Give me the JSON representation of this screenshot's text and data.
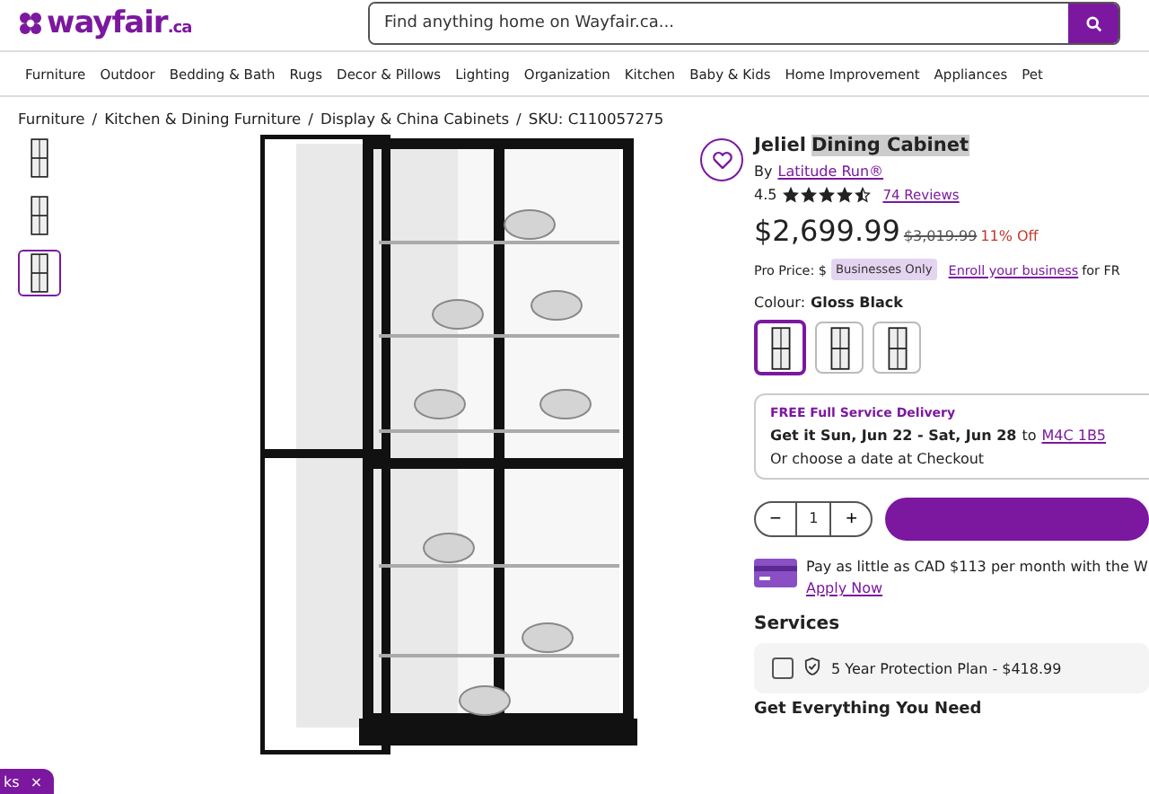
{
  "header": {
    "logo": "wayfair",
    "logo_suffix": ".ca",
    "search": {
      "placeholder": "Find anything home on Wayfair.ca..."
    }
  },
  "nav": [
    "Furniture",
    "Outdoor",
    "Bedding & Bath",
    "Rugs",
    "Decor & Pillows",
    "Lighting",
    "Organization",
    "Kitchen",
    "Baby & Kids",
    "Home Improvement",
    "Appliances",
    "Pet"
  ],
  "breadcrumb": [
    "Furniture",
    "Kitchen & Dining Furniture",
    "Display & China Cabinets",
    "SKU: C110057275"
  ],
  "breadcrumb_separator": "/",
  "thumbnails": [
    {
      "selected": false
    },
    {
      "selected": false
    },
    {
      "selected": true
    }
  ],
  "product": {
    "title": "Jeliel",
    "title_selected": "Dining Cabinet",
    "by": "By",
    "brand": "Latitude Run®",
    "rating": "4.5",
    "stars": 4.5,
    "reviews": "74 Reviews",
    "price": "$2,699.99",
    "was_price": "$3,019.99",
    "discount": "11% Off",
    "pro_label": "Pro Price: $",
    "pro_badge": "Businesses Only",
    "pro_link": "Enroll your business",
    "pro_tail": "for FR",
    "colour_label": "Colour:",
    "colour_value": "Gloss Black",
    "swatches": [
      {
        "selected": true
      },
      {
        "selected": false
      },
      {
        "selected": false
      }
    ]
  },
  "delivery": {
    "label": "FREE Full Service Delivery",
    "dates": "Get it Sun, Jun 22 - Sat, Jun 28",
    "to": "to",
    "zip": "M4C 1B5",
    "alt": "Or choose a date at Checkout"
  },
  "quantity": {
    "minus": "−",
    "value": "1",
    "plus": "+"
  },
  "financing": {
    "text": "Pay as little as CAD $113 per month with the W",
    "link": "Apply Now"
  },
  "services": {
    "heading": "Services",
    "items": [
      {
        "label": "5 Year Protection Plan - $418.99",
        "checked": false
      }
    ]
  },
  "next_heading": "Get Everything You Need",
  "chip": {
    "label": "ks",
    "close": "×"
  }
}
